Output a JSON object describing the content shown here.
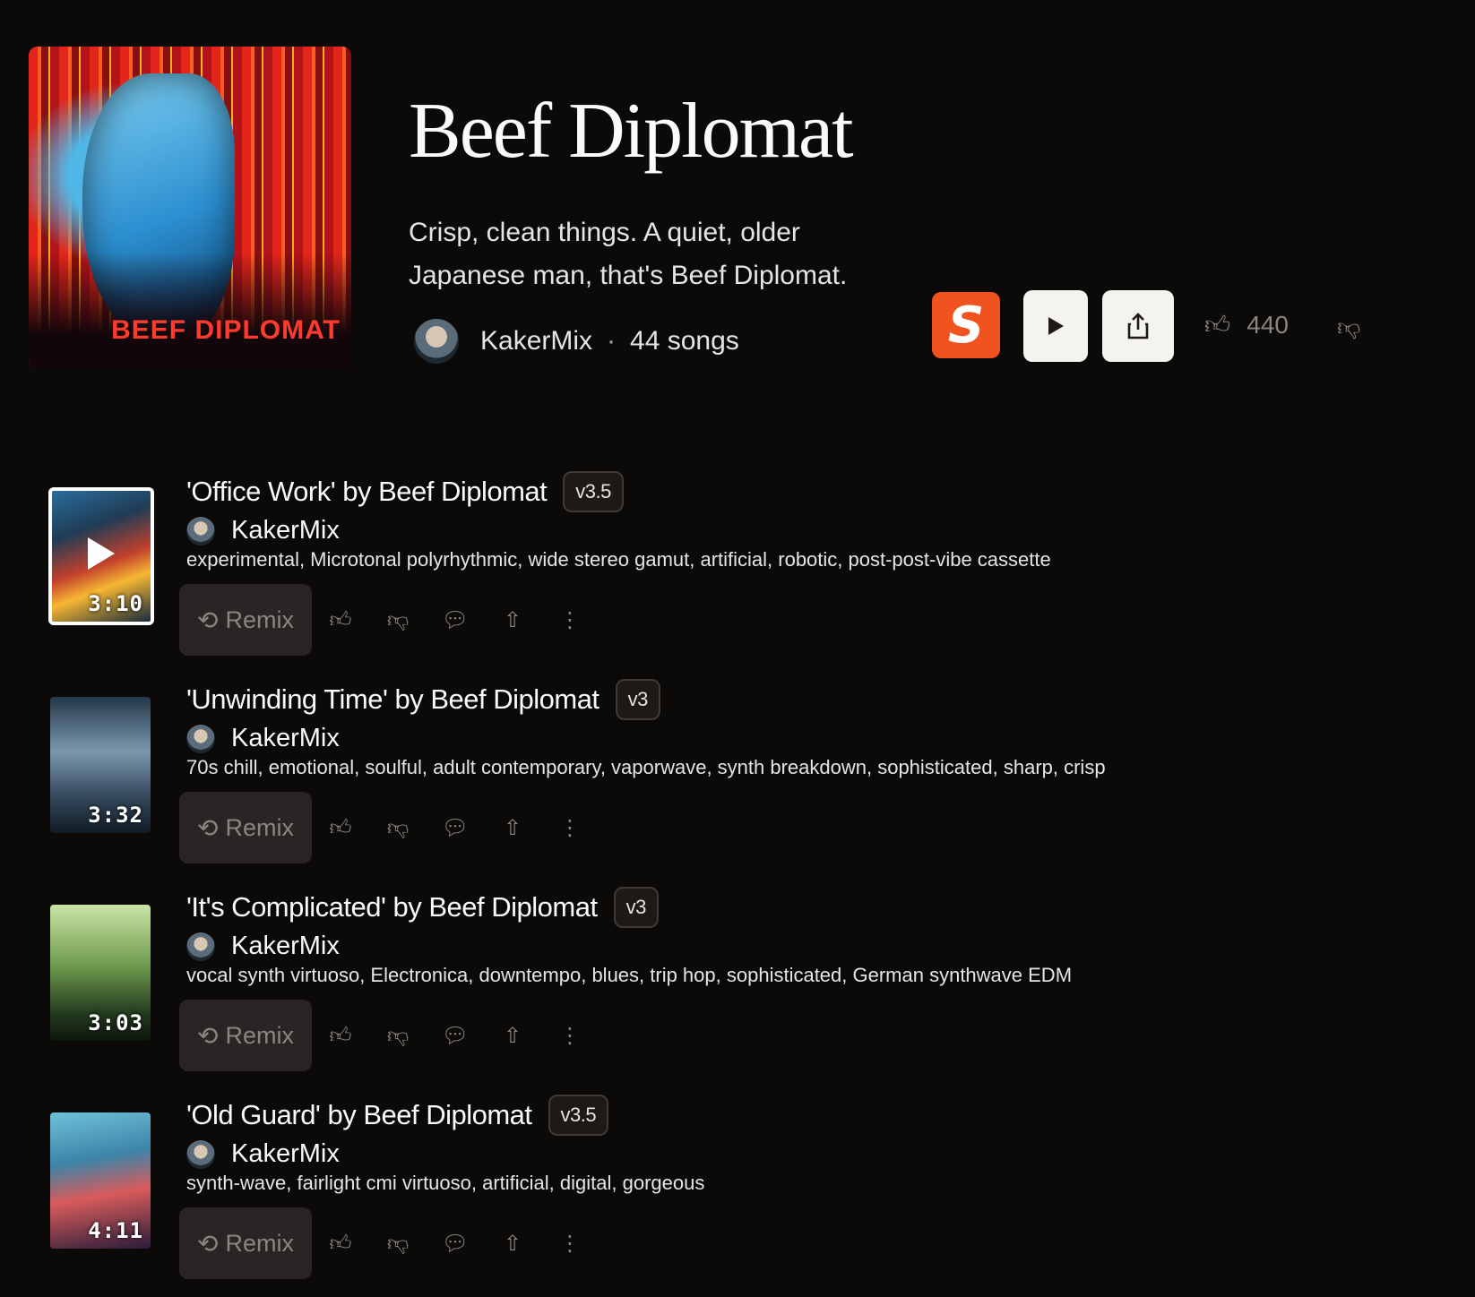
{
  "playlist": {
    "cover_text": "BEEF DIPLOMAT",
    "title": "Beef Diplomat",
    "description_line1": "Crisp, clean things. A quiet, older",
    "description_line2": "Japanese man, that's Beef Diplomat.",
    "creator": "KakerMix",
    "separator": "·",
    "song_count": "44 songs",
    "likes": "440"
  },
  "actions": {
    "remix_label": "Remix",
    "s_logo": "S"
  },
  "songs": [
    {
      "title": "'Office Work' by Beef Diplomat",
      "version": "v3.5",
      "artist": "KakerMix",
      "tags": "experimental, Microtonal polyrhythmic, wide stereo gamut, artificial, robotic, post-post-vibe cassette",
      "duration": "3:10"
    },
    {
      "title": "'Unwinding Time' by Beef Diplomat",
      "version": "v3",
      "artist": "KakerMix",
      "tags": "70s chill, emotional, soulful, adult contemporary, vaporwave, synth breakdown, sophisticated, sharp, crisp",
      "duration": "3:32"
    },
    {
      "title": "'It's Complicated' by Beef Diplomat",
      "version": "v3",
      "artist": "KakerMix",
      "tags": "vocal synth virtuoso, Electronica, downtempo, blues, trip hop, sophisticated, German synthwave EDM",
      "duration": "3:03"
    },
    {
      "title": "'Old Guard' by Beef Diplomat",
      "version": "v3.5",
      "artist": "KakerMix",
      "tags": "synth-wave, fairlight cmi virtuoso, artificial, digital, gorgeous",
      "duration": "4:11"
    }
  ],
  "colors": {
    "background": "#0c0a09",
    "accent": "#f0531f",
    "cover_text": "#ff3b2e"
  }
}
